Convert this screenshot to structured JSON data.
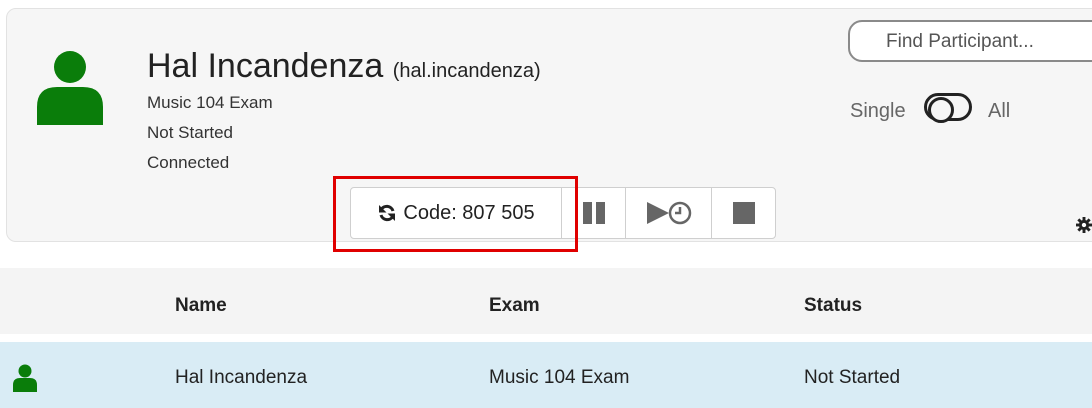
{
  "participant": {
    "name": "Hal Incandenza",
    "username": "(hal.incandenza)",
    "exam": "Music 104 Exam",
    "exam_status": "Not Started",
    "connection": "Connected"
  },
  "controls": {
    "find_label": "Find Participant...",
    "toggle_left": "Single",
    "toggle_right": "All",
    "code_label": "Code: 807 505"
  },
  "colors": {
    "avatar": "#0a7d0a",
    "highlight": "#e00000",
    "selected_row": "#d9ecf5"
  },
  "table": {
    "headers": [
      "Name",
      "Exam",
      "Status"
    ],
    "rows": [
      {
        "name": "Hal Incandenza",
        "exam": "Music 104 Exam",
        "status": "Not Started"
      }
    ]
  }
}
